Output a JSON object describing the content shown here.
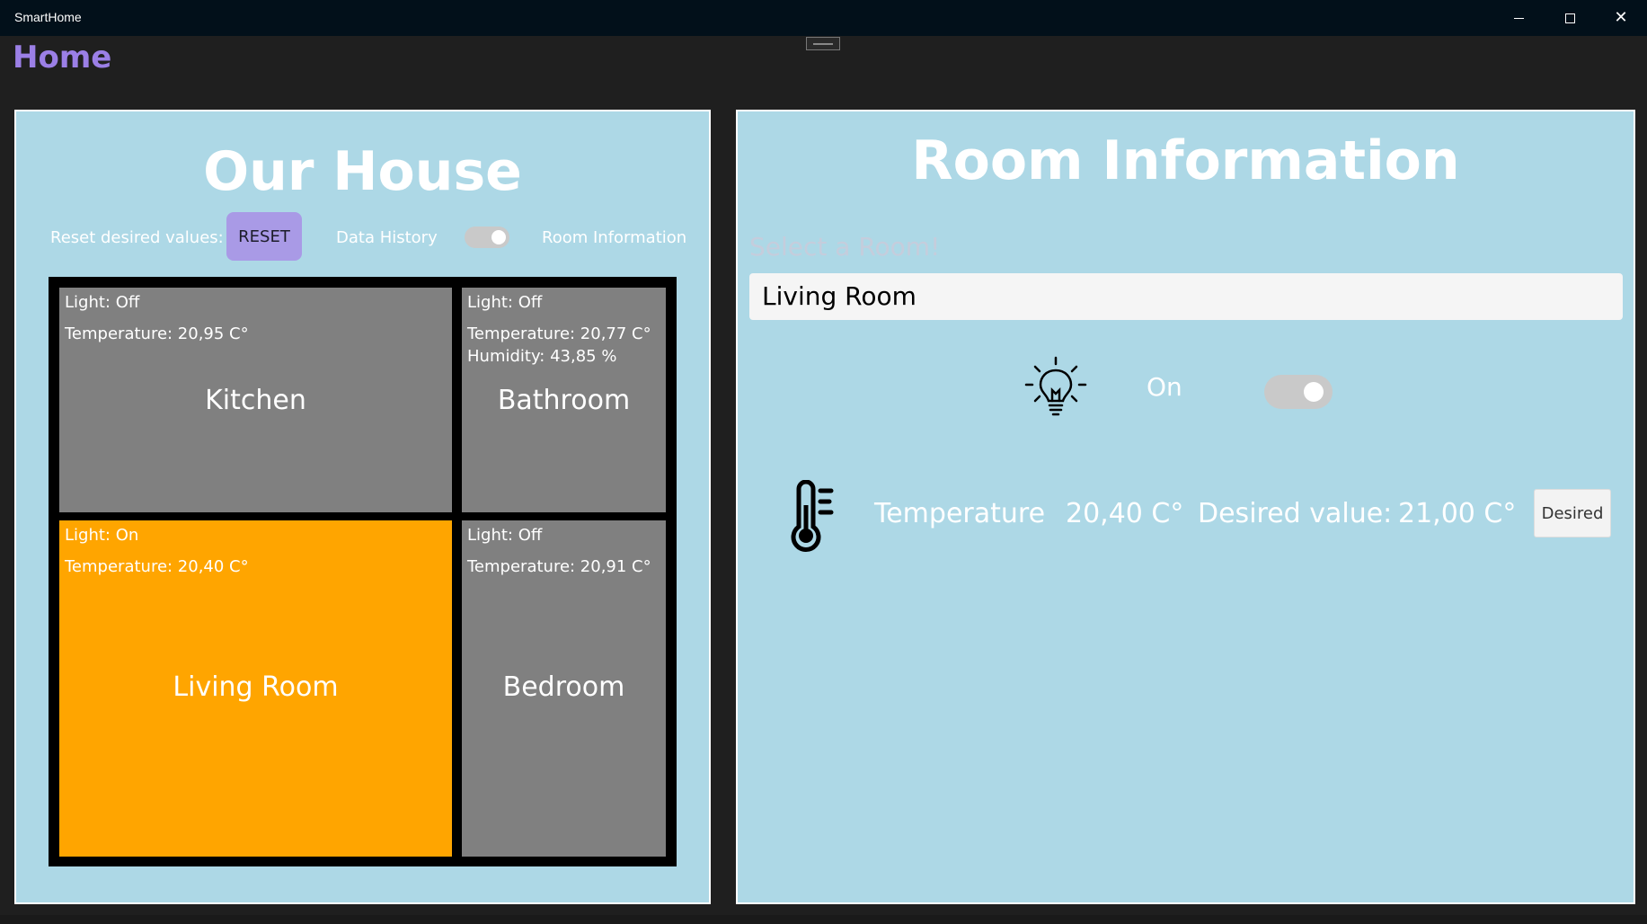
{
  "window": {
    "title": "SmartHome",
    "minimize": "minimize",
    "maximize": "maximize",
    "close": "✕"
  },
  "page": {
    "title": "Home"
  },
  "house": {
    "title": "Our House",
    "reset_label": "Reset desired values:",
    "reset_button": "RESET",
    "history_label": "Data History",
    "history_toggle_on": true,
    "room_info_label": "Room Information",
    "rooms": [
      {
        "name": "Kitchen",
        "light_label": "Light:",
        "light_value": "Off",
        "temperature": "Temperature: 20,95 C°",
        "color": "#808080"
      },
      {
        "name": "Bathroom",
        "light_label": "Light:",
        "light_value": "Off",
        "temperature": "Temperature: 20,77 C°",
        "humidity": "Humidity: 43,85 %",
        "color": "#808080"
      },
      {
        "name": "Living Room",
        "light_label": "Light:",
        "light_value": "On",
        "temperature": "Temperature: 20,40 C°",
        "color": "#ffa500"
      },
      {
        "name": "Bedroom",
        "light_label": "Light:",
        "light_value": "Off",
        "temperature": "Temperature: 20,91 C°",
        "color": "#808080"
      }
    ]
  },
  "room_info": {
    "title": "Room Information",
    "select_placeholder": "Select a Room!",
    "selected_room": "Living Room",
    "light_icon": "lightbulb-icon",
    "light_state": "On",
    "light_toggle_on": true,
    "temp_icon": "thermometer-icon",
    "temperature_label": "Temperature",
    "temperature_value": "20,40 C°",
    "desired_label": "Desired value:",
    "desired_value": "21,00 C°",
    "desired_button": "Desired"
  }
}
